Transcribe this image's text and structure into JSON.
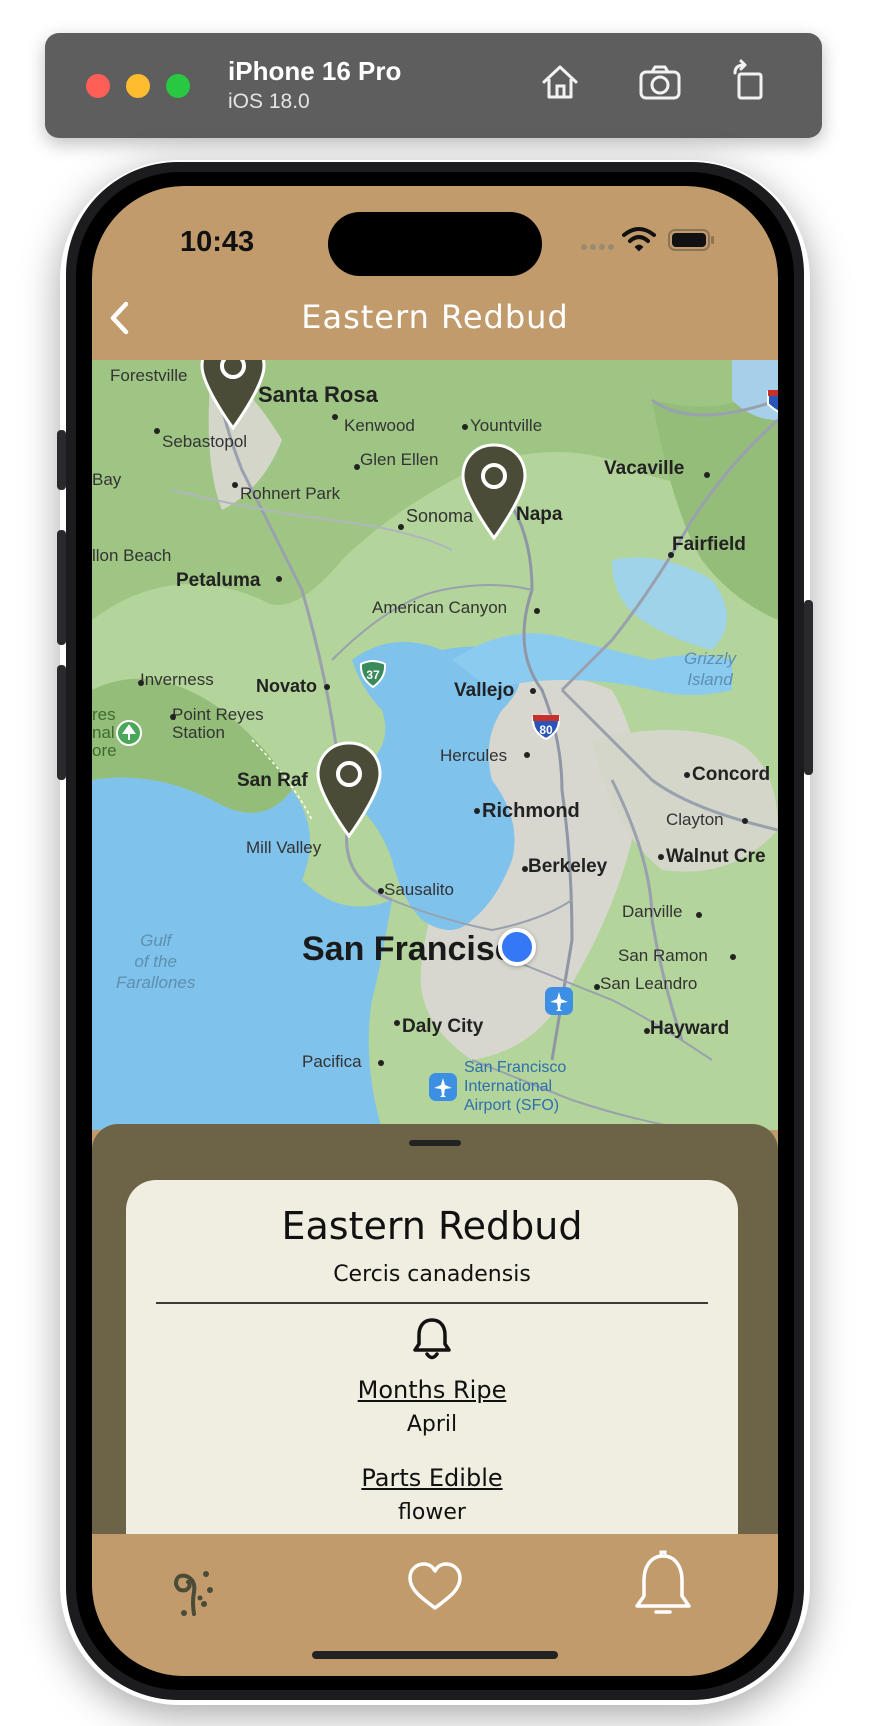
{
  "simulator": {
    "device_name": "iPhone 16 Pro",
    "os_version": "iOS 18.0",
    "toolbar_icons": [
      "home-icon",
      "screenshot-camera-icon",
      "rotate-icon"
    ],
    "traffic_light_colors": [
      "#ff5f57",
      "#febc2e",
      "#28c840"
    ]
  },
  "status_bar": {
    "time": "10:43"
  },
  "nav": {
    "title": "Eastern Redbud",
    "back_icon": "chevron-left-icon"
  },
  "map": {
    "labels": {
      "forestville": "Forestville",
      "santa_rosa": "Santa Rosa",
      "kenwood": "Kenwood",
      "yountville": "Yountville",
      "sebastopol": "Sebastopol",
      "glen_ellen": "Glen Ellen",
      "vacaville": "Vacaville",
      "bay": "Bay",
      "rohnert_park": "Rohnert Park",
      "sonoma": "Sonoma",
      "napa": "Napa",
      "fairfield": "Fairfield",
      "dillon_beach": "llon Beach",
      "petaluma": "Petaluma",
      "american_canyon": "American Canyon",
      "grizzly_island": "Grizzly\nIsland",
      "inverness": "Inverness",
      "novato": "Novato",
      "vallejo": "Vallejo",
      "point_reyes": "Point Reyes\nStation",
      "pr_left": "res\nnal\nore",
      "hercules": "Hercules",
      "san_rafael": "San Raf",
      "concord": "Concord",
      "richmond": "Richmond",
      "clayton": "Clayton",
      "mill_valley": "Mill Valley",
      "walnut_creek": "Walnut Cre",
      "berkeley": "Berkeley",
      "sausalito": "Sausalito",
      "danville": "Danville",
      "gulf": "Gulf\nof the\nFarallones",
      "san_francisco": "San Francisco",
      "san_ramon": "San Ramon",
      "san_leandro": "San Leandro",
      "daly_city": "Daly City",
      "hayward": "Hayward",
      "pacifica": "Pacifica",
      "sfo": "San Francisco\nInternational\nAirport (SFO)",
      "shield_37": "37",
      "shield_80": "80"
    },
    "pin_color": "#4a4c38",
    "user_location_color": "#3478f6"
  },
  "plant_card": {
    "common_name": "Eastern Redbud",
    "scientific_name": "Cercis canadensis",
    "months_ripe_label": "Months Ripe",
    "months_ripe_value": "April",
    "parts_edible_label": "Parts Edible",
    "parts_edible_value": "flower",
    "reminder_icon": "bell-icon"
  },
  "tab_bar": {
    "tabs": [
      {
        "name": "plants",
        "icon": "sprout-icon",
        "active": true
      },
      {
        "name": "favorites",
        "icon": "heart-icon",
        "active": false
      },
      {
        "name": "reminders",
        "icon": "bell-icon",
        "active": false
      }
    ],
    "background": "#c19b6c",
    "active_color": "#4a4c38"
  }
}
